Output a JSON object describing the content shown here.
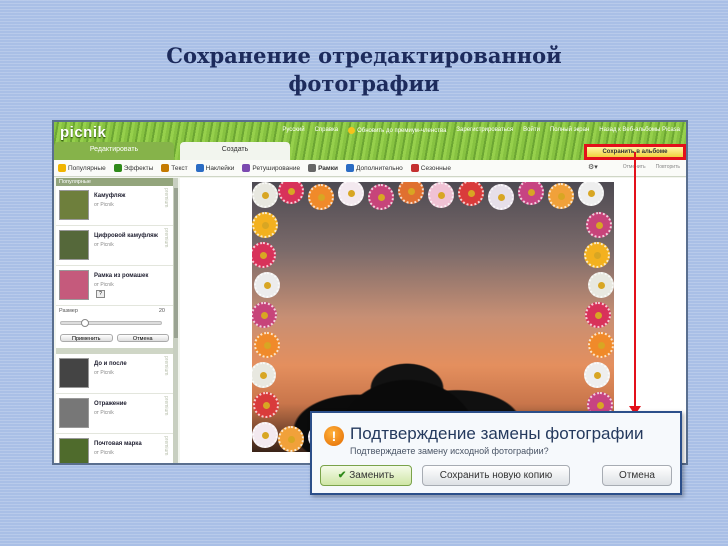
{
  "slide": {
    "title_line1": "Сохранение отредактированной",
    "title_line2": "фотографии"
  },
  "app": {
    "logo": "picnik",
    "top_menu": [
      "Русский",
      "Справка",
      "Обновить до премиум-членства",
      "Зарегистрироваться",
      "Войти",
      "Полный экран",
      "Назад к Веб-альбомы Picasa"
    ],
    "tabs": [
      "Редактировать",
      "Создать"
    ],
    "save_button": "Сохранить в альбоме",
    "toolbar": [
      {
        "label": "Популярные",
        "color": "#f0b400"
      },
      {
        "label": "Эффекты",
        "color": "#2f8a1a"
      },
      {
        "label": "Текст",
        "color": "#c47a00"
      },
      {
        "label": "Наклейки",
        "color": "#2b6cc4"
      },
      {
        "label": "Ретуширование",
        "color": "#7b4ab0"
      },
      {
        "label": "Рамки",
        "color": "#666666"
      },
      {
        "label": "Дополнительно",
        "color": "#2b6cc4"
      },
      {
        "label": "Сезонные",
        "color": "#c43030"
      }
    ],
    "undo_labels": [
      "Отменить",
      "Повторить"
    ],
    "sidebar": {
      "section": "Популярные",
      "effects": [
        {
          "name": "Камуфляж",
          "by": "от Picnik",
          "prem": "premium",
          "thumb": "#6e7f3c"
        },
        {
          "name": "Цифровой камуфляж",
          "by": "от Picnik",
          "prem": "premium",
          "thumb": "#55683a"
        },
        {
          "name": "Рамка из ромашек",
          "by": "от Picnik",
          "prem": "",
          "thumb": "#c55a7c"
        }
      ],
      "size_label": "Размер",
      "size_value": "20",
      "apply": "Применить",
      "cancel": "Отмена",
      "effects2": [
        {
          "name": "До и после",
          "by": "от Picnik",
          "prem": "premium",
          "thumb": "#444444"
        },
        {
          "name": "Отражение",
          "by": "от Picnik",
          "prem": "premium",
          "thumb": "#777777"
        },
        {
          "name": "Почтовая марка",
          "by": "от Picnik",
          "prem": "premium",
          "thumb": "#4f6b2c"
        }
      ]
    }
  },
  "dialog": {
    "title": "Подтверждение замены фотографии",
    "subtitle": "Подтверждаете замену исходной фотографии?",
    "replace": "Заменить",
    "save_copy": "Сохранить новую копию",
    "cancel": "Отмена"
  }
}
